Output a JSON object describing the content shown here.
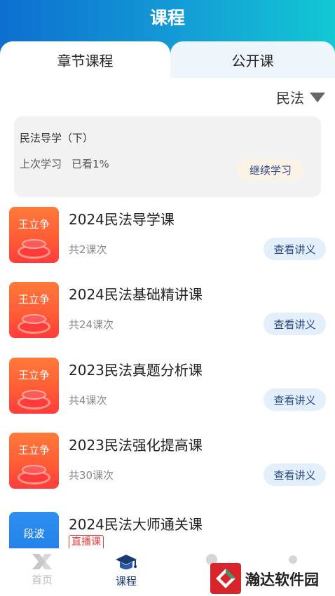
{
  "header": {
    "title": "课程"
  },
  "tabs": [
    {
      "label": "章节课程",
      "active": true
    },
    {
      "label": "公开课",
      "active": false
    }
  ],
  "subject": {
    "selected": "民法"
  },
  "last_study": {
    "title": "民法导学（下）",
    "last_label": "上次学习",
    "progress_text": "已看1%",
    "continue_label": "继续学习"
  },
  "courses": [
    {
      "teacher": "王立争",
      "title": "2024民法导学课",
      "count": "共2课次",
      "action": "查看讲义"
    },
    {
      "teacher": "王立争",
      "title": "2024民法基础精讲课",
      "count": "共24课次",
      "action": "查看讲义"
    },
    {
      "teacher": "王立争",
      "title": "2023民法真题分析课",
      "count": "共4课次",
      "action": "查看讲义"
    },
    {
      "teacher": "王立争",
      "title": "2023民法强化提高课",
      "count": "共30课次",
      "action": "查看讲义"
    },
    {
      "teacher": "段波",
      "title": "2024民法大师通关课",
      "badge": "直播课"
    }
  ],
  "bottom_nav": [
    {
      "label": "首页",
      "icon": "home-x-icon"
    },
    {
      "label": "课程",
      "icon": "graduation-cap-icon"
    }
  ],
  "watermark": {
    "text": "瀚达软件园"
  },
  "colors": {
    "header_start": "#0d6fd0",
    "header_end": "#12c8d2",
    "accent_text": "#2b4a88",
    "thumb_orange": "#ff5a36",
    "thumb_blue": "#2f8ff0",
    "live_red": "#e23b3b"
  }
}
